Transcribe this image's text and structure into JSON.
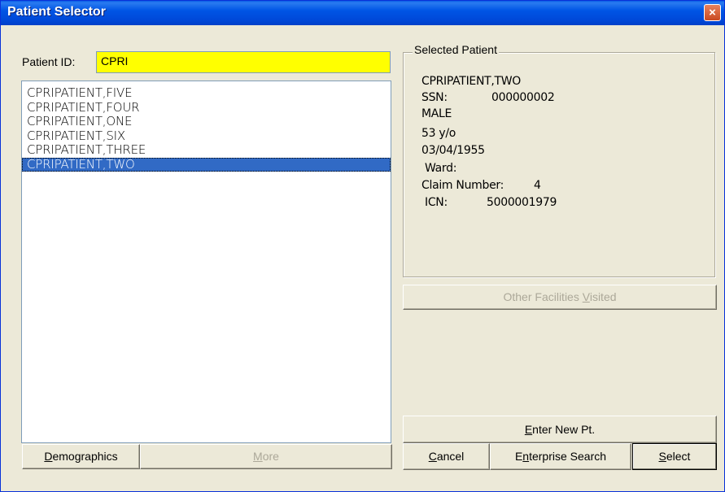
{
  "window": {
    "title": "Patient Selector",
    "close_icon": "×"
  },
  "patient_id": {
    "label": "Patient ID:",
    "value": "CPRI"
  },
  "patient_list": [
    "CPRIPATIENT,FIVE",
    "CPRIPATIENT,FOUR",
    "CPRIPATIENT,ONE",
    "CPRIPATIENT,SIX",
    "CPRIPATIENT,THREE",
    "CPRIPATIENT,TWO"
  ],
  "selected_index": 5,
  "selected_patient": {
    "group_title": "Selected Patient",
    "name": "CPRIPATIENT,TWO",
    "ssn_label": "SSN:",
    "ssn_value": "000000002",
    "sex": "MALE",
    "age": "53 y/o",
    "dob": "03/04/1955",
    "ward_label": "Ward:",
    "claim_label": "Claim Number:",
    "claim_value": "4",
    "icn_label": "ICN:",
    "icn_value": "5000001979"
  },
  "buttons": {
    "other_facilities": {
      "pre": "Other Facilities ",
      "u": "V",
      "post": "isited"
    },
    "enter_new": {
      "pre": "",
      "u": "E",
      "post": "nter New Pt."
    },
    "cancel": {
      "pre": "",
      "u": "C",
      "post": "ancel"
    },
    "enterprise": {
      "pre": "E",
      "u": "n",
      "post": "terprise Search"
    },
    "select": {
      "pre": "",
      "u": "S",
      "post": "elect"
    },
    "demographics": {
      "pre": "",
      "u": "D",
      "post": "emographics"
    },
    "more": {
      "pre": "",
      "u": "M",
      "post": "ore"
    }
  }
}
